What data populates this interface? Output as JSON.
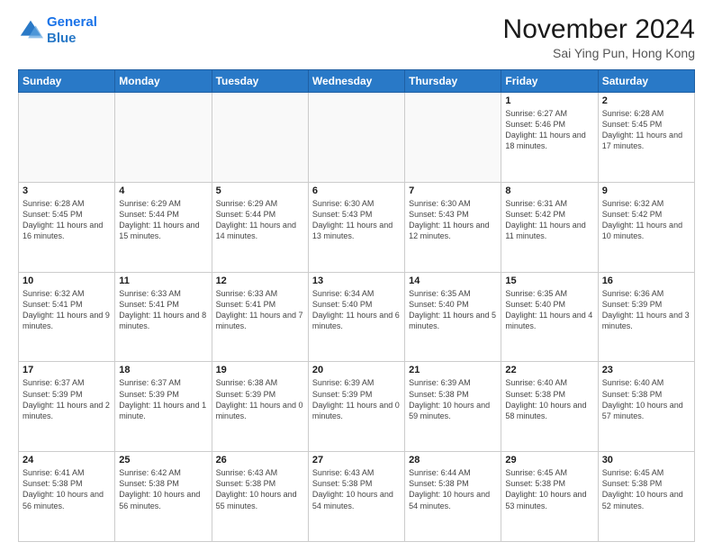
{
  "logo": {
    "line1": "General",
    "line2": "Blue"
  },
  "title": "November 2024",
  "subtitle": "Sai Ying Pun, Hong Kong",
  "days_of_week": [
    "Sunday",
    "Monday",
    "Tuesday",
    "Wednesday",
    "Thursday",
    "Friday",
    "Saturday"
  ],
  "weeks": [
    [
      {
        "day": "",
        "info": ""
      },
      {
        "day": "",
        "info": ""
      },
      {
        "day": "",
        "info": ""
      },
      {
        "day": "",
        "info": ""
      },
      {
        "day": "",
        "info": ""
      },
      {
        "day": "1",
        "info": "Sunrise: 6:27 AM\nSunset: 5:46 PM\nDaylight: 11 hours and 18 minutes."
      },
      {
        "day": "2",
        "info": "Sunrise: 6:28 AM\nSunset: 5:45 PM\nDaylight: 11 hours and 17 minutes."
      }
    ],
    [
      {
        "day": "3",
        "info": "Sunrise: 6:28 AM\nSunset: 5:45 PM\nDaylight: 11 hours and 16 minutes."
      },
      {
        "day": "4",
        "info": "Sunrise: 6:29 AM\nSunset: 5:44 PM\nDaylight: 11 hours and 15 minutes."
      },
      {
        "day": "5",
        "info": "Sunrise: 6:29 AM\nSunset: 5:44 PM\nDaylight: 11 hours and 14 minutes."
      },
      {
        "day": "6",
        "info": "Sunrise: 6:30 AM\nSunset: 5:43 PM\nDaylight: 11 hours and 13 minutes."
      },
      {
        "day": "7",
        "info": "Sunrise: 6:30 AM\nSunset: 5:43 PM\nDaylight: 11 hours and 12 minutes."
      },
      {
        "day": "8",
        "info": "Sunrise: 6:31 AM\nSunset: 5:42 PM\nDaylight: 11 hours and 11 minutes."
      },
      {
        "day": "9",
        "info": "Sunrise: 6:32 AM\nSunset: 5:42 PM\nDaylight: 11 hours and 10 minutes."
      }
    ],
    [
      {
        "day": "10",
        "info": "Sunrise: 6:32 AM\nSunset: 5:41 PM\nDaylight: 11 hours and 9 minutes."
      },
      {
        "day": "11",
        "info": "Sunrise: 6:33 AM\nSunset: 5:41 PM\nDaylight: 11 hours and 8 minutes."
      },
      {
        "day": "12",
        "info": "Sunrise: 6:33 AM\nSunset: 5:41 PM\nDaylight: 11 hours and 7 minutes."
      },
      {
        "day": "13",
        "info": "Sunrise: 6:34 AM\nSunset: 5:40 PM\nDaylight: 11 hours and 6 minutes."
      },
      {
        "day": "14",
        "info": "Sunrise: 6:35 AM\nSunset: 5:40 PM\nDaylight: 11 hours and 5 minutes."
      },
      {
        "day": "15",
        "info": "Sunrise: 6:35 AM\nSunset: 5:40 PM\nDaylight: 11 hours and 4 minutes."
      },
      {
        "day": "16",
        "info": "Sunrise: 6:36 AM\nSunset: 5:39 PM\nDaylight: 11 hours and 3 minutes."
      }
    ],
    [
      {
        "day": "17",
        "info": "Sunrise: 6:37 AM\nSunset: 5:39 PM\nDaylight: 11 hours and 2 minutes."
      },
      {
        "day": "18",
        "info": "Sunrise: 6:37 AM\nSunset: 5:39 PM\nDaylight: 11 hours and 1 minute."
      },
      {
        "day": "19",
        "info": "Sunrise: 6:38 AM\nSunset: 5:39 PM\nDaylight: 11 hours and 0 minutes."
      },
      {
        "day": "20",
        "info": "Sunrise: 6:39 AM\nSunset: 5:39 PM\nDaylight: 11 hours and 0 minutes."
      },
      {
        "day": "21",
        "info": "Sunrise: 6:39 AM\nSunset: 5:38 PM\nDaylight: 10 hours and 59 minutes."
      },
      {
        "day": "22",
        "info": "Sunrise: 6:40 AM\nSunset: 5:38 PM\nDaylight: 10 hours and 58 minutes."
      },
      {
        "day": "23",
        "info": "Sunrise: 6:40 AM\nSunset: 5:38 PM\nDaylight: 10 hours and 57 minutes."
      }
    ],
    [
      {
        "day": "24",
        "info": "Sunrise: 6:41 AM\nSunset: 5:38 PM\nDaylight: 10 hours and 56 minutes."
      },
      {
        "day": "25",
        "info": "Sunrise: 6:42 AM\nSunset: 5:38 PM\nDaylight: 10 hours and 56 minutes."
      },
      {
        "day": "26",
        "info": "Sunrise: 6:43 AM\nSunset: 5:38 PM\nDaylight: 10 hours and 55 minutes."
      },
      {
        "day": "27",
        "info": "Sunrise: 6:43 AM\nSunset: 5:38 PM\nDaylight: 10 hours and 54 minutes."
      },
      {
        "day": "28",
        "info": "Sunrise: 6:44 AM\nSunset: 5:38 PM\nDaylight: 10 hours and 54 minutes."
      },
      {
        "day": "29",
        "info": "Sunrise: 6:45 AM\nSunset: 5:38 PM\nDaylight: 10 hours and 53 minutes."
      },
      {
        "day": "30",
        "info": "Sunrise: 6:45 AM\nSunset: 5:38 PM\nDaylight: 10 hours and 52 minutes."
      }
    ]
  ]
}
